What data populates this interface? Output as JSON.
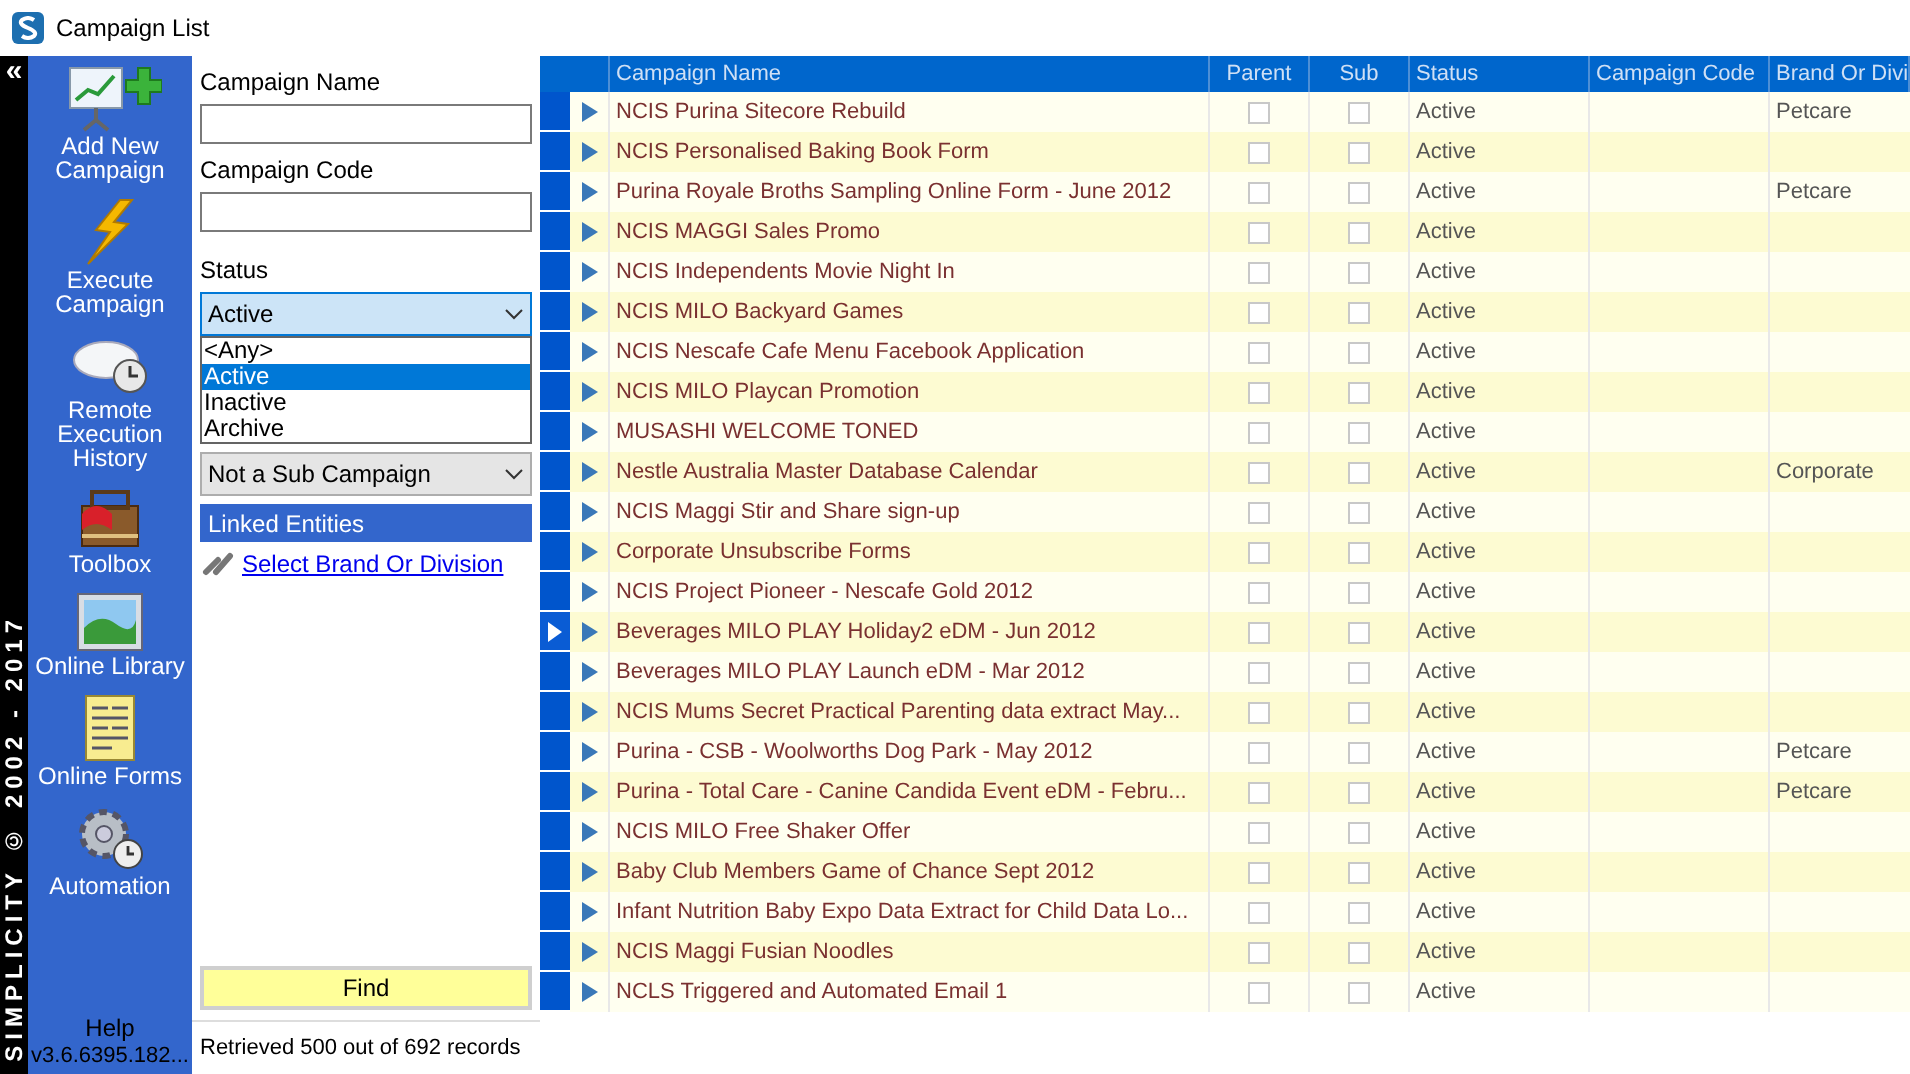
{
  "window": {
    "title": "Campaign List"
  },
  "brand_strip": {
    "text": "SIMPLICITY © 2002 - 2017",
    "collapse": "«"
  },
  "sidebar": {
    "items": [
      {
        "kind": "add",
        "label": "Add New Campaign"
      },
      {
        "kind": "execute",
        "label": "Execute Campaign"
      },
      {
        "kind": "remote",
        "label": "Remote Execution History"
      },
      {
        "kind": "toolbox",
        "label": "Toolbox"
      },
      {
        "kind": "library",
        "label": "Online Library"
      },
      {
        "kind": "forms",
        "label": "Online Forms"
      },
      {
        "kind": "automation",
        "label": "Automation"
      }
    ],
    "help": "Help",
    "version": "v3.6.6395.182..."
  },
  "filters": {
    "campaign_name": {
      "label": "Campaign Name"
    },
    "campaign_code": {
      "label": "Campaign Code"
    },
    "status": {
      "label": "Status",
      "value": "Active",
      "expanded": true,
      "options": [
        {
          "label": "<Any>",
          "selected": false
        },
        {
          "label": "Active",
          "selected": true
        },
        {
          "label": "Inactive",
          "selected": false
        },
        {
          "label": "Archive",
          "selected": false
        }
      ]
    },
    "child_campaigns": {
      "value": "Not a Sub Campaign"
    },
    "linked_entities": {
      "title": "Linked Entities",
      "link": "Select Brand Or Division"
    },
    "find_button": "Find"
  },
  "status_bar": "Retrieved 500 out of 692 records",
  "table": {
    "columns": [
      "Campaign Name",
      "Parent",
      "Sub",
      "Status",
      "Campaign Code",
      "Brand Or Divi"
    ],
    "rows": [
      {
        "name": "NCIS Purina Sitecore Rebuild",
        "parent": false,
        "sub": false,
        "status": "Active",
        "brand": "Petcare",
        "current": false
      },
      {
        "name": "NCIS Personalised Baking Book Form",
        "parent": false,
        "sub": false,
        "status": "Active",
        "current": false
      },
      {
        "name": "Purina Royale Broths Sampling Online Form - June 2012",
        "parent": false,
        "sub": false,
        "status": "Active",
        "brand": "Petcare",
        "current": false
      },
      {
        "name": "NCIS MAGGI Sales Promo",
        "parent": false,
        "sub": false,
        "status": "Active",
        "current": false
      },
      {
        "name": "NCIS Independents Movie Night In",
        "parent": false,
        "sub": false,
        "status": "Active",
        "current": false
      },
      {
        "name": "NCIS MILO Backyard Games",
        "parent": false,
        "sub": false,
        "status": "Active",
        "current": false
      },
      {
        "name": "NCIS Nescafe Cafe Menu Facebook Application",
        "parent": false,
        "sub": false,
        "status": "Active",
        "current": false
      },
      {
        "name": "NCIS MILO Playcan Promotion",
        "parent": false,
        "sub": false,
        "status": "Active",
        "current": false
      },
      {
        "name": "MUSASHI WELCOME TONED",
        "parent": false,
        "sub": false,
        "status": "Active",
        "current": false
      },
      {
        "name": "Nestle Australia Master Database Calendar",
        "parent": false,
        "sub": false,
        "status": "Active",
        "brand": "Corporate",
        "current": false
      },
      {
        "name": "NCIS Maggi Stir and Share sign-up",
        "parent": false,
        "sub": false,
        "status": "Active",
        "current": false
      },
      {
        "name": "Corporate Unsubscribe Forms",
        "parent": false,
        "sub": false,
        "status": "Active",
        "current": false
      },
      {
        "name": "NCIS Project Pioneer - Nescafe Gold 2012",
        "parent": false,
        "sub": false,
        "status": "Active",
        "current": false
      },
      {
        "name": "Beverages MILO PLAY Holiday2 eDM - Jun 2012",
        "parent": false,
        "sub": false,
        "status": "Active",
        "current": true
      },
      {
        "name": "Beverages MILO PLAY Launch eDM - Mar 2012",
        "parent": false,
        "sub": false,
        "status": "Active",
        "current": false
      },
      {
        "name": "NCIS Mums Secret Practical Parenting data extract May...",
        "parent": false,
        "sub": false,
        "status": "Active",
        "current": false
      },
      {
        "name": "Purina - CSB - Woolworths Dog Park - May 2012",
        "parent": false,
        "sub": false,
        "status": "Active",
        "brand": "Petcare",
        "current": false
      },
      {
        "name": "Purina - Total Care - Canine Candida Event eDM - Febru...",
        "parent": false,
        "sub": false,
        "status": "Active",
        "brand": "Petcare",
        "current": false
      },
      {
        "name": "NCIS MILO Free Shaker Offer",
        "parent": false,
        "sub": false,
        "status": "Active",
        "current": false
      },
      {
        "name": "Baby Club Members Game of Chance Sept 2012",
        "parent": false,
        "sub": false,
        "status": "Active",
        "current": false
      },
      {
        "name": "Infant Nutrition Baby Expo Data Extract for Child Data Lo...",
        "parent": false,
        "sub": false,
        "status": "Active",
        "current": false
      },
      {
        "name": "NCIS Maggi Fusian Noodles",
        "parent": false,
        "sub": false,
        "status": "Active",
        "current": false
      },
      {
        "name": "NCLS Triggered and Automated Email 1",
        "parent": false,
        "sub": false,
        "status": "Active",
        "current": false
      }
    ]
  }
}
